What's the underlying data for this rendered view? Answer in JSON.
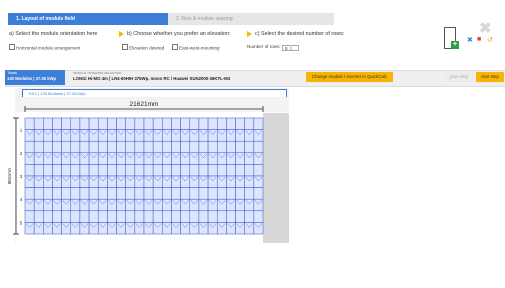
{
  "tabs": [
    {
      "label": "1.  Layout of module field",
      "active": true
    },
    {
      "label": "2.  Row & module spacing",
      "active": false
    }
  ],
  "steps": {
    "a": "a) Select the module orientation here",
    "b": "b) Choose whether you prefer an elevation:",
    "c": "c) Select the desired number of rows:"
  },
  "options": {
    "horizontal": "Horizontal module arrangement",
    "elevation": "Elevation desired",
    "east_west": "East-west-mounting",
    "rows_label": "Number of rows:",
    "rows_value": "5"
  },
  "summary": {
    "title": "Totals",
    "value": "130 Modules | 37.05 kWp"
  },
  "module_info": {
    "label": "MODULE / INVERTER SELECTION",
    "value": "LONGi Hi-MO 4m | LR4-60HIH 375Wp, mono RC / Huawei SUN2000-36KTL-M3"
  },
  "buttons": {
    "change": "Change module / inverter in QuickCalc",
    "prev": "prev step",
    "next": "next step"
  },
  "field": {
    "tab_label": "FA 1 | 130 Modules | 37.05 kWp",
    "width_label": "21621mm",
    "height_label": "8651mm",
    "row_numbers": [
      "1",
      "2",
      "3",
      "4",
      "5"
    ],
    "rows": 5,
    "columns": 26
  },
  "colors": {
    "accent": "#3d7fd8",
    "button": "#f7b500",
    "module_fill": "#dde6ff",
    "module_stroke": "#3b4fd6"
  }
}
